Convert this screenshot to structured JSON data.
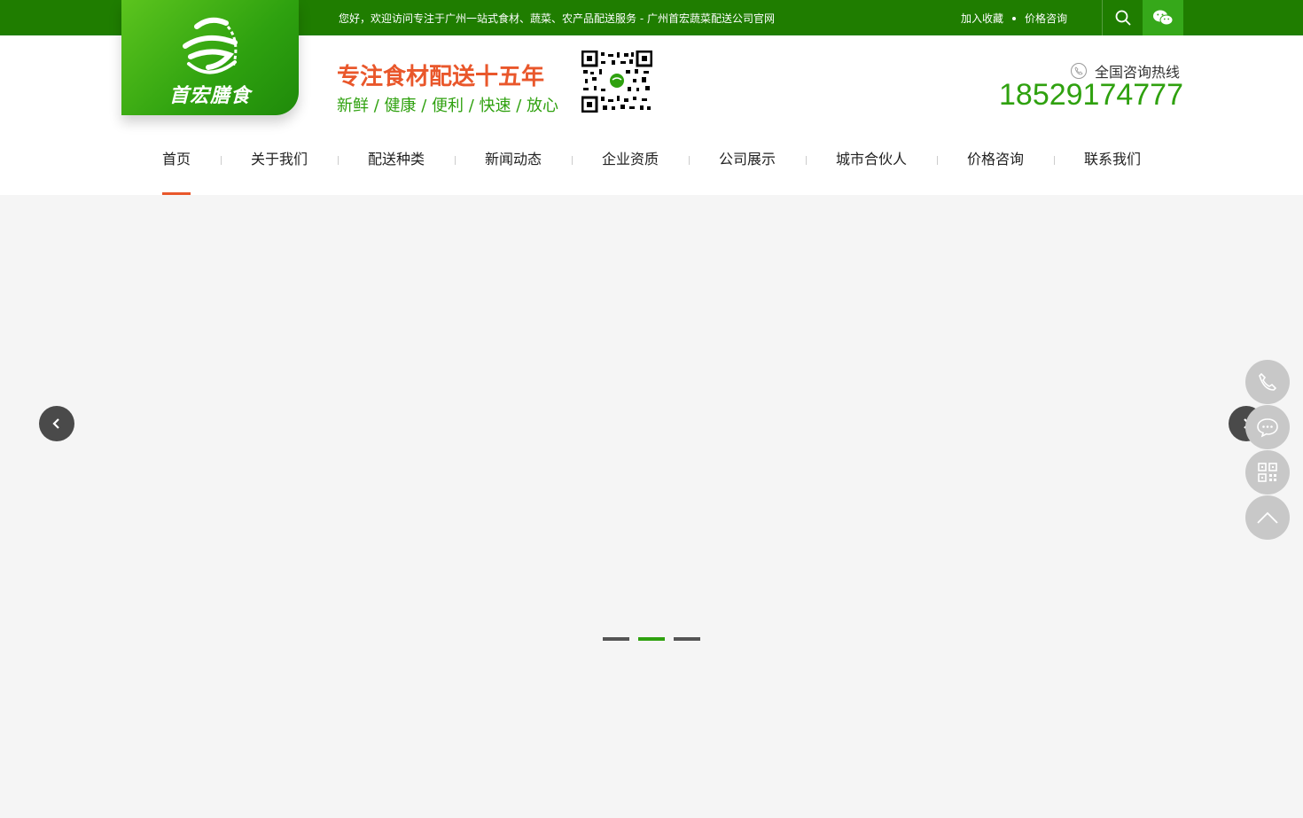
{
  "topbar": {
    "welcome": "您好，欢迎访问专注于广州一站式食材、蔬菜、农产品配送服务 - 广州首宏蔬菜配送公司官网",
    "favorite": "加入收藏",
    "price": "价格咨询",
    "search_icon": "search-icon",
    "wechat_icon": "wechat-icon"
  },
  "logo": {
    "text": "首宏膳食"
  },
  "slogan": {
    "main": "专注食材配送十五年",
    "sub": "新鲜 / 健康 / 便利 / 快速 / 放心"
  },
  "hotline": {
    "label": "全国咨询热线",
    "number": "18529174777"
  },
  "nav": {
    "items": [
      "首页",
      "关于我们",
      "配送种类",
      "新闻动态",
      "企业资质",
      "公司展示",
      "城市合伙人",
      "价格咨询",
      "联系我们"
    ],
    "active_index": 0
  },
  "banner": {
    "slide_count": 3,
    "active_slide": 2
  },
  "side_tools": [
    "phone-icon",
    "chat-icon",
    "qrcode-icon",
    "back-to-top-icon"
  ],
  "colors": {
    "brand_green": "#1f7d00",
    "accent_green": "#2fa10f",
    "accent_orange": "#e9572b"
  }
}
